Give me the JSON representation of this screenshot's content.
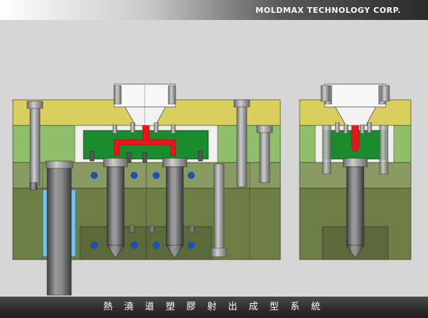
{
  "header": {
    "title": "MOLDMAX TECHNOLOGY CORP."
  },
  "footer": {
    "caption": "熱 澆 道 塑 膠 射 出 成 型 系 統"
  },
  "colors": {
    "background": "#d6d6d6",
    "clamp_plate": "#d9cf5f",
    "cavity_plate": "#8fbf6a",
    "manifold": "#1c8a2e",
    "melt_channel": "#e8151b",
    "core_plate": "#6e7f45",
    "cooling_channel": "#1e4fb3",
    "leader_pin_sleeve": "#6ec3e6",
    "nozzle_steel": "#7b7b7b"
  }
}
